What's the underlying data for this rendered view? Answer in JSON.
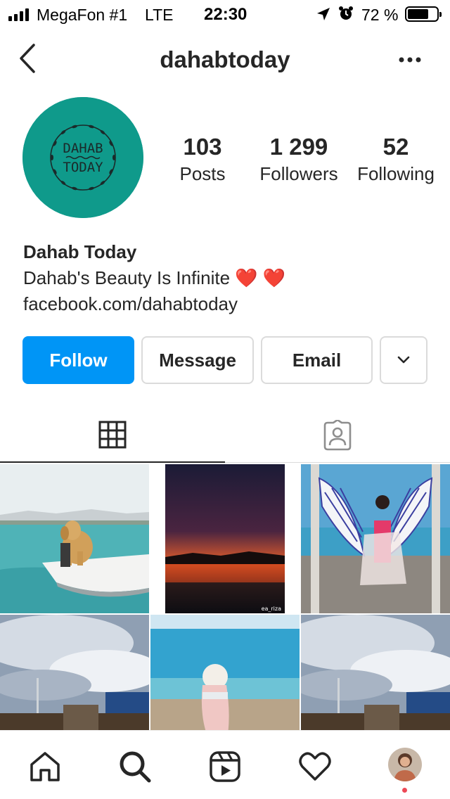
{
  "status_bar": {
    "carrier": "MegaFon #1",
    "network": "LTE",
    "time": "22:30",
    "battery_percent": "72 %",
    "battery_level": 0.72,
    "icons": [
      "signal-icon",
      "location-icon",
      "alarm-icon",
      "battery-icon"
    ]
  },
  "header": {
    "username": "dahabtoday",
    "back_icon": "chevron-left-icon",
    "more_icon": "more-horizontal-icon"
  },
  "profile": {
    "avatar_text_line1": "DAHAB",
    "avatar_text_line2": "TODAY",
    "avatar_color": "#0f9a8b",
    "stats": {
      "posts": {
        "value": "103",
        "label": "Posts"
      },
      "followers": {
        "value": "1 299",
        "label": "Followers"
      },
      "following": {
        "value": "52",
        "label": "Following"
      }
    },
    "display_name": "Dahab Today",
    "bio": "Dahab's Beauty Is Infinite ❤️ ❤️",
    "link": "facebook.com/dahabtoday"
  },
  "actions": {
    "follow": "Follow",
    "message": "Message",
    "email": "Email",
    "more_icon": "chevron-down-icon"
  },
  "tabs": {
    "grid_icon": "grid-icon",
    "tagged_icon": "tagged-person-icon"
  },
  "grid": {
    "posts": [
      {
        "name": "post-dog-boat"
      },
      {
        "name": "post-sunset",
        "watermark": "ea_riza"
      },
      {
        "name": "post-wings"
      },
      {
        "name": "post-sky-buildings-1"
      },
      {
        "name": "post-beach-woman"
      },
      {
        "name": "post-sky-buildings-2"
      }
    ]
  },
  "bottom_nav": {
    "items": [
      "home-icon",
      "search-icon",
      "reels-icon",
      "heart-icon",
      "profile-avatar"
    ]
  },
  "colors": {
    "accent": "#0095f6",
    "text": "#262626",
    "border": "#dbdbdb",
    "notification": "#ed4956"
  }
}
